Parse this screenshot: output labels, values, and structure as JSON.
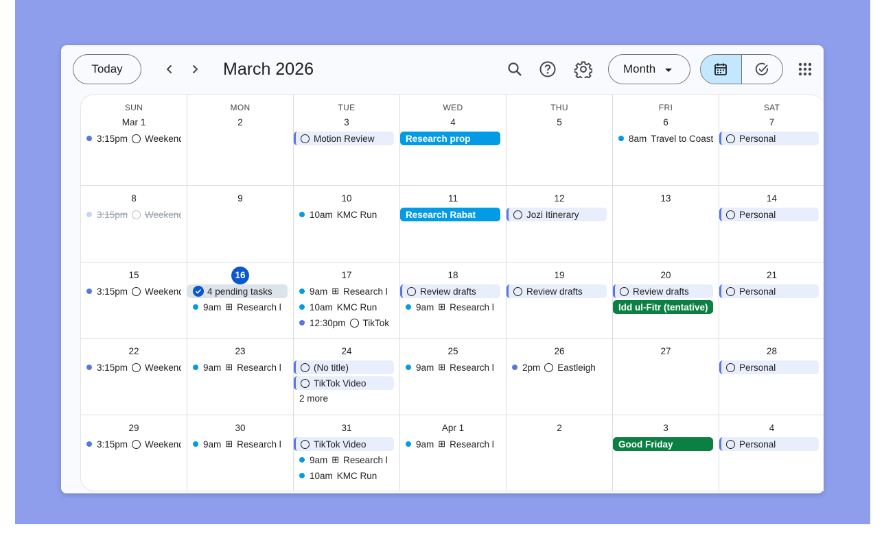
{
  "toolbar": {
    "today_label": "Today",
    "title": "March 2026",
    "view_label": "Month",
    "icons": [
      "chevron-left",
      "chevron-right",
      "search",
      "help",
      "settings",
      "calendar",
      "tasks",
      "apps-grid"
    ]
  },
  "colors": {
    "accent": "#0b57d0",
    "background": "#8f9eec",
    "event_blue": "#039be5",
    "event_green": "#0b8043",
    "task_border": "#5877e6"
  },
  "weekdays": [
    "SUN",
    "MON",
    "TUE",
    "WED",
    "THU",
    "FRI",
    "SAT"
  ],
  "weeks": [
    [
      {
        "label": "Mar 1",
        "events": [
          {
            "kind": "dot",
            "color": "#5877e6",
            "time": "3:15pm",
            "icon": "circle",
            "title": "Weekend"
          }
        ]
      },
      {
        "label": "2",
        "events": []
      },
      {
        "label": "3",
        "events": [
          {
            "kind": "task",
            "title": "Motion Review"
          }
        ]
      },
      {
        "label": "4",
        "events": [
          {
            "kind": "fill-blue",
            "title": "Research prop"
          }
        ]
      },
      {
        "label": "5",
        "events": []
      },
      {
        "label": "6",
        "events": [
          {
            "kind": "dot",
            "color": "#039be5",
            "time": "8am",
            "title": "Travel to Coast"
          }
        ]
      },
      {
        "label": "7",
        "events": [
          {
            "kind": "task",
            "title": "Personal"
          }
        ]
      }
    ],
    [
      {
        "label": "8",
        "events": [
          {
            "kind": "done",
            "color": "#c6d4f5",
            "time": "3:15pm",
            "icon": "check-circle",
            "title": "Weekend"
          }
        ]
      },
      {
        "label": "9",
        "events": []
      },
      {
        "label": "10",
        "events": [
          {
            "kind": "dot",
            "color": "#039be5",
            "time": "10am",
            "title": "KMC Run"
          }
        ]
      },
      {
        "label": "11",
        "events": [
          {
            "kind": "fill-blue",
            "title": "Research Rabat"
          }
        ]
      },
      {
        "label": "12",
        "events": [
          {
            "kind": "task",
            "title": "Jozi Itinerary"
          }
        ]
      },
      {
        "label": "13",
        "events": []
      },
      {
        "label": "14",
        "events": [
          {
            "kind": "task",
            "title": "Personal"
          }
        ]
      }
    ],
    [
      {
        "label": "15",
        "events": [
          {
            "kind": "dot",
            "color": "#5877e6",
            "time": "3:15pm",
            "icon": "circle",
            "title": "Weekend"
          }
        ]
      },
      {
        "label": "16",
        "today": true,
        "events": [
          {
            "kind": "pending",
            "title": "4 pending tasks"
          },
          {
            "kind": "dot",
            "color": "#039be5",
            "time": "9am",
            "icon": "grid",
            "title": "Research l"
          }
        ]
      },
      {
        "label": "17",
        "events": [
          {
            "kind": "dot",
            "color": "#039be5",
            "time": "9am",
            "icon": "grid",
            "title": "Research l"
          },
          {
            "kind": "dot",
            "color": "#039be5",
            "time": "10am",
            "title": "KMC Run"
          },
          {
            "kind": "dot",
            "color": "#5877e6",
            "time": "12:30pm",
            "icon": "circle",
            "title": "TikTok"
          }
        ]
      },
      {
        "label": "18",
        "events": [
          {
            "kind": "task",
            "title": "Review drafts"
          },
          {
            "kind": "dot",
            "color": "#039be5",
            "time": "9am",
            "icon": "grid",
            "title": "Research l"
          }
        ]
      },
      {
        "label": "19",
        "events": [
          {
            "kind": "task",
            "title": "Review drafts"
          }
        ]
      },
      {
        "label": "20",
        "events": [
          {
            "kind": "task",
            "title": "Review drafts"
          },
          {
            "kind": "fill-green",
            "title": "Idd ul-Fitr (tentative)"
          }
        ]
      },
      {
        "label": "21",
        "events": [
          {
            "kind": "task",
            "title": "Personal"
          }
        ]
      }
    ],
    [
      {
        "label": "22",
        "events": [
          {
            "kind": "dot",
            "color": "#5877e6",
            "time": "3:15pm",
            "icon": "circle",
            "title": "Weekend"
          }
        ]
      },
      {
        "label": "23",
        "events": [
          {
            "kind": "dot",
            "color": "#039be5",
            "time": "9am",
            "icon": "grid",
            "title": "Research l"
          }
        ]
      },
      {
        "label": "24",
        "events": [
          {
            "kind": "task",
            "title": "(No title)"
          },
          {
            "kind": "task",
            "title": "TikTok Video"
          }
        ],
        "more": "2 more"
      },
      {
        "label": "25",
        "events": [
          {
            "kind": "dot",
            "color": "#039be5",
            "time": "9am",
            "icon": "grid",
            "title": "Research l"
          }
        ]
      },
      {
        "label": "26",
        "events": [
          {
            "kind": "dot",
            "color": "#5877e6",
            "time": "2pm",
            "icon": "circle",
            "title": "Eastleigh"
          }
        ]
      },
      {
        "label": "27",
        "events": []
      },
      {
        "label": "28",
        "events": [
          {
            "kind": "task",
            "title": "Personal"
          }
        ]
      }
    ],
    [
      {
        "label": "29",
        "events": [
          {
            "kind": "dot",
            "color": "#5877e6",
            "time": "3:15pm",
            "icon": "circle",
            "title": "Weekend"
          }
        ]
      },
      {
        "label": "30",
        "events": [
          {
            "kind": "dot",
            "color": "#039be5",
            "time": "9am",
            "icon": "grid",
            "title": "Research l"
          }
        ]
      },
      {
        "label": "31",
        "events": [
          {
            "kind": "task",
            "title": "TikTok Video"
          },
          {
            "kind": "dot",
            "color": "#039be5",
            "time": "9am",
            "icon": "grid",
            "title": "Research l"
          },
          {
            "kind": "dot",
            "color": "#039be5",
            "time": "10am",
            "title": "KMC Run"
          }
        ]
      },
      {
        "label": "Apr 1",
        "events": [
          {
            "kind": "dot",
            "color": "#039be5",
            "time": "9am",
            "icon": "grid",
            "title": "Research l"
          }
        ]
      },
      {
        "label": "2",
        "events": []
      },
      {
        "label": "3",
        "events": [
          {
            "kind": "fill-green",
            "title": "Good Friday"
          }
        ]
      },
      {
        "label": "4",
        "events": [
          {
            "kind": "task",
            "title": "Personal"
          }
        ]
      }
    ]
  ]
}
